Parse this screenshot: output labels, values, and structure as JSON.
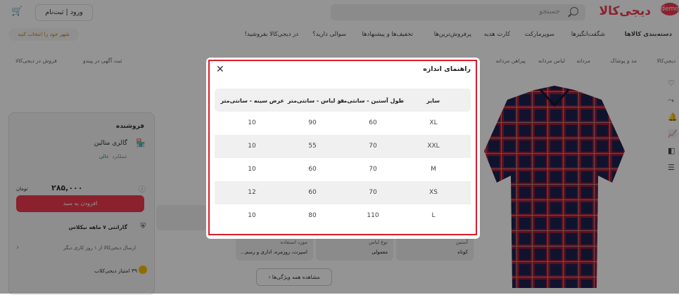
{
  "header": {
    "logo": "دیجی‌کالا",
    "logo_badge": "demo",
    "search_placeholder": "جستجو",
    "login": "ورود | ثبت‌نام",
    "cart_icon": "cart-icon",
    "nav": [
      "دسته‌بندی کالاها",
      "شگفت‌انگیزها",
      "سوپرمارکت",
      "کارت هدیه",
      "پرفروش‌ترین‌ها",
      "تخفیف‌ها و پیشنهادها",
      "سوالی دارید؟",
      "در دیجی‌کالا بفروشید!"
    ],
    "location": "شهر خود را انتخاب کنید"
  },
  "breadcrumb": [
    "دیجی‌کالا",
    "مد و پوشاک",
    "مردانه",
    "لباس مردانه",
    "پیراهن مردانه"
  ],
  "top_links": {
    "sell": "فروش در دیجی‌کالا",
    "ad": "ثبت آگهی در پیندو"
  },
  "seller": {
    "title": "فروشنده",
    "name": "گالری متالین",
    "performance_label": "عملکرد",
    "performance": "عالی",
    "price": "۲۸۵,۰۰۰",
    "currency": "تومان",
    "add_to_cart": "افزودن به سبد",
    "warranty": "گارانتی ۷ ماهه نیکلاس",
    "shipping": "ارسال دیجی‌کالا از ۱ روز کاری دیگر",
    "points": "۳۹ امتیاز دیجی‌کلاب"
  },
  "specs": [
    {
      "label": "آستین",
      "value": "کوتاه"
    },
    {
      "label": "نوع لباس",
      "value": "معمولی"
    },
    {
      "label": "مورد استفاده",
      "value": "اسپرت، روزمره، اداری و رسم..."
    }
  ],
  "all_specs_button": "مشاهده همه ویژگی‌ها",
  "modal": {
    "title": "راهنمای اندازه",
    "headers": [
      "سایز",
      "طول آستین - سانتی‌متر",
      "قد لباس - سانتی‌متر",
      "عرض سینه - سانتی‌متر"
    ],
    "rows": [
      [
        "XL",
        "60",
        "90",
        "10"
      ],
      [
        "XXL",
        "70",
        "55",
        "10"
      ],
      [
        "M",
        "70",
        "60",
        "10"
      ],
      [
        "XS",
        "70",
        "60",
        "12"
      ],
      [
        "L",
        "110",
        "80",
        "10"
      ]
    ]
  },
  "colors": {
    "brand": "#ef394e",
    "highlight": "#d91c2a"
  }
}
